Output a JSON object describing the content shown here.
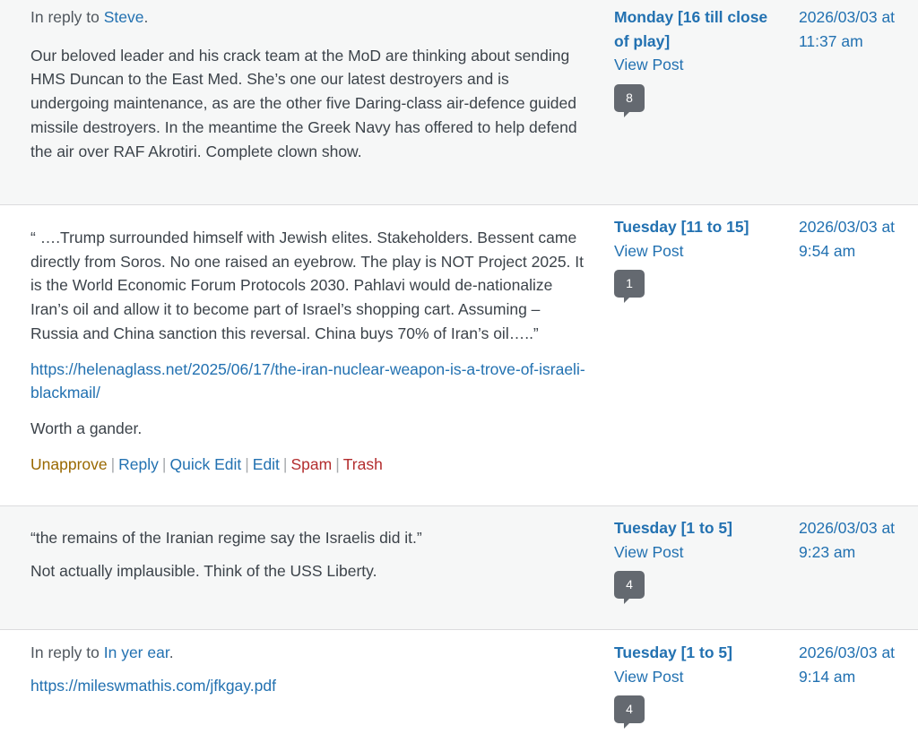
{
  "rows": [
    {
      "reply_prefix": "In reply to",
      "reply_author": "Steve",
      "reply_suffix": ".",
      "body": "Our beloved leader and his crack team at the MoD are thinking about sending HMS Duncan to the East Med. She’s one our latest destroyers and is undergoing maintenance, as are the other five Daring-class air-defence guided missile destroyers. In the meantime the Greek Navy has offered to help defend the air over RAF Akrotiri. Complete clown show.",
      "post_title": "Monday [16 till close of play]",
      "view_post": "View Post",
      "count": "8",
      "date": "2026/03/03 at 11:37 am"
    },
    {
      "quote": "“ ….Trump surrounded himself with Jewish elites. Stakeholders. Bessent came directly from Soros. No one raised an eyebrow. The play is NOT Project 2025. It is the World Economic Forum Protocols 2030. Pahlavi would de-nationalize Iran’s oil and allow it to become part of Israel’s shopping cart. Assuming – Russia and China sanction this reversal. China buys 70% of Iran’s oil…..”",
      "link": "https://helenaglass.net/2025/06/17/the-iran-nuclear-weapon-is-a-trove-of-israeli-blackmail/",
      "closing": "Worth a gander.",
      "actions": {
        "unapprove": "Unapprove",
        "reply": "Reply",
        "quick_edit": "Quick Edit",
        "edit": "Edit",
        "spam": "Spam",
        "trash": "Trash",
        "separator": "|"
      },
      "post_title": "Tuesday [11 to 15]",
      "view_post": "View Post",
      "count": "1",
      "date": "2026/03/03 at 9:54 am"
    },
    {
      "line1": "“the remains of the Iranian regime say the Israelis did it.”",
      "line2": "Not actually implausible. Think of the USS Liberty.",
      "post_title": "Tuesday [1 to 5]",
      "view_post": "View Post",
      "count": "4",
      "date": "2026/03/03 at 9:23 am"
    },
    {
      "reply_prefix": "In reply to",
      "reply_author": "In yer ear",
      "reply_suffix": ".",
      "link": "https://mileswmathis.com/jfkgay.pdf",
      "post_title": "Tuesday [1 to 5]",
      "view_post": "View Post",
      "count": "4",
      "date": "2026/03/03 at 9:14 am"
    }
  ]
}
